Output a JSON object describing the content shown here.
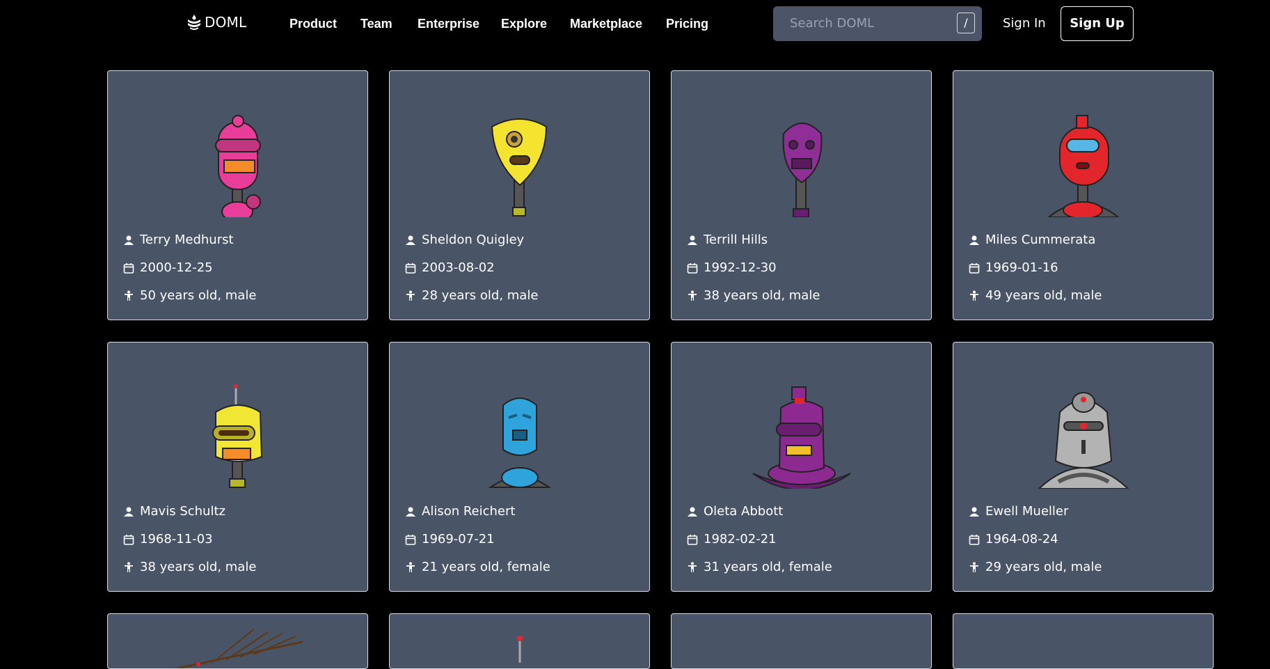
{
  "header": {
    "logo_text": "DOML",
    "nav": [
      "Product",
      "Team",
      "Enterprise",
      "Explore",
      "Marketplace",
      "Pricing"
    ],
    "search_placeholder": "Search DOML",
    "search_shortcut": "/",
    "sign_in": "Sign In",
    "sign_up": "Sign Up"
  },
  "users": [
    {
      "name": "Terry Medhurst",
      "birth_date": "2000-12-25",
      "details": "50 years old, male",
      "robot_color": "#e83e9a"
    },
    {
      "name": "Sheldon Quigley",
      "birth_date": "2003-08-02",
      "details": "28 years old, male",
      "robot_color": "#f4e430"
    },
    {
      "name": "Terrill Hills",
      "birth_date": "1992-12-30",
      "details": "38 years old, male",
      "robot_color": "#8e2e96"
    },
    {
      "name": "Miles Cummerata",
      "birth_date": "1969-01-16",
      "details": "49 years old, male",
      "robot_color": "#e2262c"
    },
    {
      "name": "Mavis Schultz",
      "birth_date": "1968-11-03",
      "details": "38 years old, male",
      "robot_color": "#f0e633"
    },
    {
      "name": "Alison Reichert",
      "birth_date": "1969-07-21",
      "details": "21 years old, female",
      "robot_color": "#2ea3dc"
    },
    {
      "name": "Oleta Abbott",
      "birth_date": "1982-02-21",
      "details": "31 years old, female",
      "robot_color": "#8c2a92"
    },
    {
      "name": "Ewell Mueller",
      "birth_date": "1964-08-24",
      "details": "29 years old, male",
      "robot_color": "#b3b3b3"
    }
  ],
  "icons": {
    "person": "person-icon",
    "date": "calendar-icon",
    "age": "person-standing-icon"
  }
}
